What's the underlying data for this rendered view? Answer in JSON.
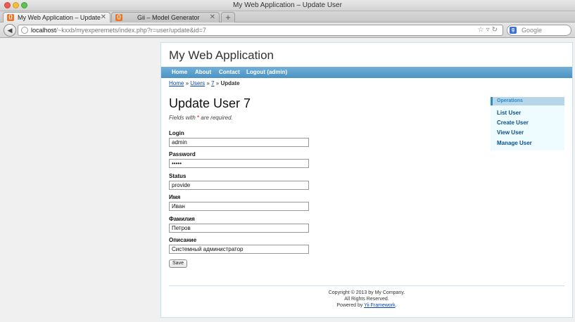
{
  "window": {
    "title": "My Web Application – Update User"
  },
  "tabs": [
    {
      "label": "My Web Application – Update U…",
      "favicon": "yii-icon"
    },
    {
      "label": "Gii – Model Generator",
      "favicon": "yii-icon"
    }
  ],
  "navbar": {
    "url_host": "localhost",
    "url_rest": "/~kxxb/myexperemets/index.php?r=user/update&id=7",
    "search_placeholder": "Google"
  },
  "app": {
    "title": "My Web Application",
    "menu": [
      "Home",
      "About",
      "Contact",
      "Logout (admin)"
    ]
  },
  "breadcrumbs": {
    "home": "Home",
    "sep1": "»",
    "users": "Users",
    "sep2": "»",
    "id": "7",
    "sep3": "»",
    "current": "Update"
  },
  "form": {
    "heading": "Update User 7",
    "note_prefix": "Fields with",
    "note_star": "*",
    "note_suffix": "are required.",
    "fields": [
      {
        "label": "Login",
        "value": "admin"
      },
      {
        "label": "Password",
        "value": "•••••"
      },
      {
        "label": "Status",
        "value": "provide"
      },
      {
        "label": "Имя",
        "value": "Иван"
      },
      {
        "label": "Фамилия",
        "value": "Петров"
      },
      {
        "label": "Описание",
        "value": "Системный администратор"
      }
    ],
    "save_label": "Save"
  },
  "sidebar": {
    "title": "Operations",
    "items": [
      "List User",
      "Create User",
      "View User",
      "Manage User"
    ]
  },
  "footer": {
    "line1": "Copyright © 2013 by My Company.",
    "line2": "All Rights Reserved.",
    "line3_prefix": "Powered by",
    "line3_link": "Yii Framework",
    "line3_suffix": "."
  },
  "colors": {
    "menu_bar": "#4b92c4",
    "link": "#0645ad",
    "sidebar_bg": "#eefbff",
    "sidebar_accent": "#298dcd"
  }
}
